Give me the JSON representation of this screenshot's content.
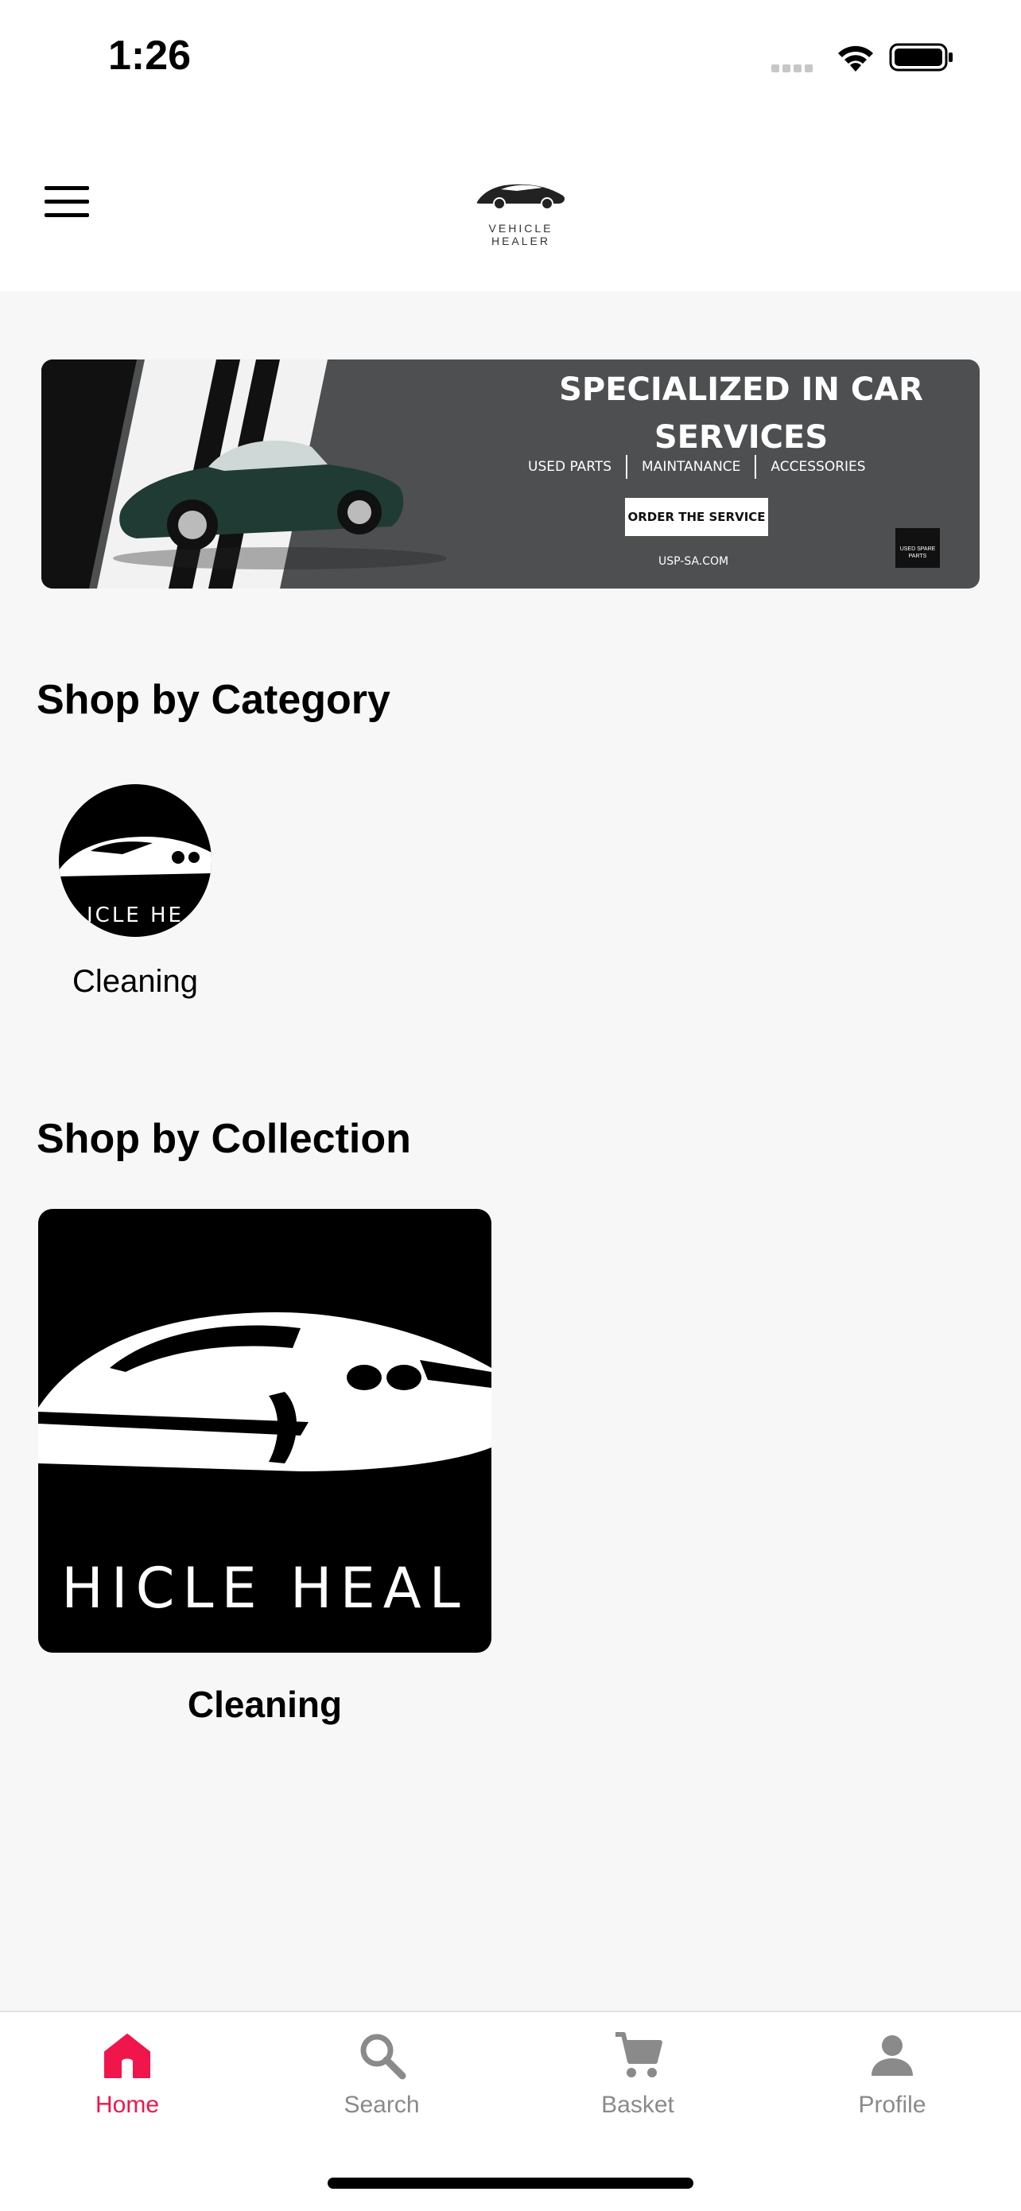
{
  "status_bar": {
    "time": "1:26"
  },
  "header": {
    "logo_text": "VEHICLE HEALER"
  },
  "banner": {
    "title": "SPECIALIZED IN CAR SERVICES",
    "subtitles": [
      "USED PARTS",
      "MAINTANANCE",
      "ACCESSORIES"
    ],
    "button_label": "ORDER THE SERVICE",
    "url": "USP-SA.COM",
    "badge_text": "USED SPARE PARTS"
  },
  "sections": {
    "category_title": "Shop by Category",
    "collection_title": "Shop by Collection"
  },
  "categories": [
    {
      "label": "Cleaning",
      "thumb_text": "ICLE HE"
    }
  ],
  "collections": [
    {
      "label": "Cleaning",
      "thumb_text": "HICLE HEAL"
    }
  ],
  "nav": {
    "items": [
      {
        "label": "Home",
        "icon": "home-icon",
        "active": true
      },
      {
        "label": "Search",
        "icon": "search-icon",
        "active": false
      },
      {
        "label": "Basket",
        "icon": "cart-icon",
        "active": false
      },
      {
        "label": "Profile",
        "icon": "person-icon",
        "active": false
      }
    ],
    "active_color": "#f0164b",
    "inactive_color": "#8a8a8a"
  }
}
